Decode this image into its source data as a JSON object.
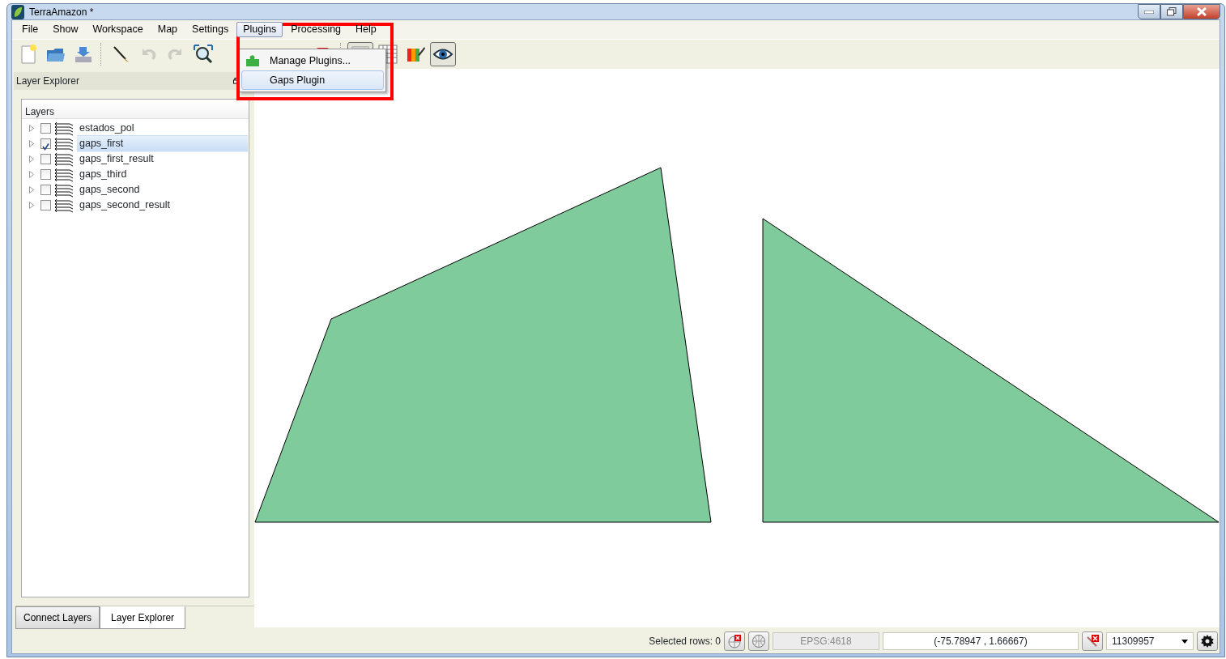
{
  "window": {
    "title": "TerraAmazon *"
  },
  "menu": [
    {
      "label": "File",
      "selected": false
    },
    {
      "label": "Show",
      "selected": false
    },
    {
      "label": "Workspace",
      "selected": false
    },
    {
      "label": "Map",
      "selected": false
    },
    {
      "label": "Settings",
      "selected": false
    },
    {
      "label": "Plugins",
      "selected": true
    },
    {
      "label": "Processing",
      "selected": false
    },
    {
      "label": "Help",
      "selected": false
    }
  ],
  "dropdown": [
    {
      "label": "Manage Plugins...",
      "selected": false,
      "kind": "plugin"
    },
    {
      "label": "Gaps Plugin",
      "selected": true,
      "kind": "plain"
    }
  ],
  "toolbar": [
    {
      "kind": "new-file",
      "disabled": false,
      "pressed": false
    },
    {
      "kind": "open-folder",
      "disabled": false,
      "pressed": false
    },
    {
      "kind": "import",
      "disabled": false,
      "pressed": false
    },
    {
      "kind": "sep"
    },
    {
      "kind": "brush",
      "disabled": false,
      "pressed": false
    },
    {
      "kind": "undo",
      "disabled": true,
      "pressed": false
    },
    {
      "kind": "redo",
      "disabled": true,
      "pressed": false
    },
    {
      "kind": "zoom-extent",
      "disabled": false,
      "pressed": false
    },
    {
      "kind": "gap"
    },
    {
      "kind": "delete",
      "disabled": false,
      "pressed": false
    },
    {
      "kind": "sep"
    },
    {
      "kind": "panel",
      "disabled": false,
      "pressed": true
    },
    {
      "kind": "grid",
      "disabled": false,
      "pressed": false
    },
    {
      "kind": "palette",
      "disabled": false,
      "pressed": false
    },
    {
      "kind": "eye",
      "disabled": false,
      "pressed": true
    }
  ],
  "dock": {
    "title": "Layer Explorer",
    "tree_header": "Layers",
    "layers": [
      {
        "name": "estados_pol",
        "checked": false,
        "selected": false
      },
      {
        "name": "gaps_first",
        "checked": true,
        "selected": true
      },
      {
        "name": "gaps_first_result",
        "checked": false,
        "selected": false
      },
      {
        "name": "gaps_third",
        "checked": false,
        "selected": false
      },
      {
        "name": "gaps_second",
        "checked": false,
        "selected": false
      },
      {
        "name": "gaps_second_result",
        "checked": false,
        "selected": false
      }
    ],
    "tabs": [
      {
        "label": "Connect Layers",
        "selected": false
      },
      {
        "label": "Layer Explorer",
        "selected": true
      }
    ]
  },
  "status_bar": {
    "selected_rows": "Selected rows: 0",
    "projection": "EPSG:4618",
    "coordinates": "(-75.78947 , 1.66667)",
    "scale": "11309957"
  }
}
